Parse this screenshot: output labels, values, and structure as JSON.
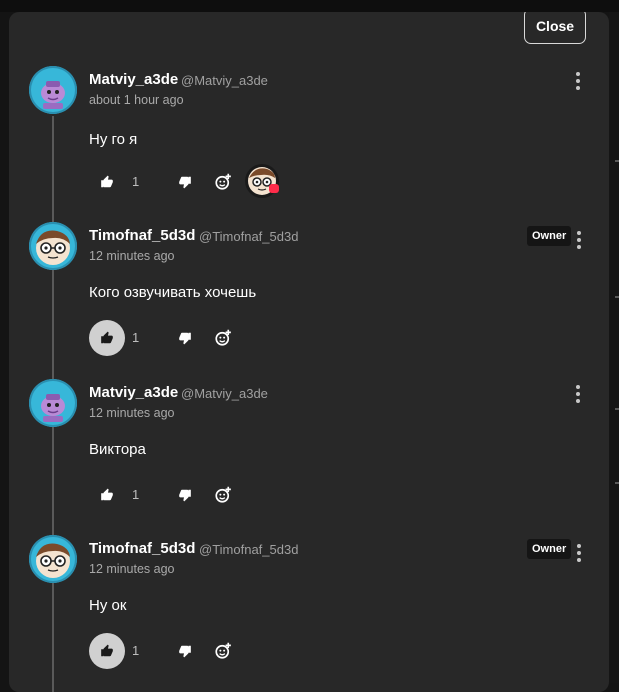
{
  "close_label": "Close",
  "owner_label": "Owner",
  "comments": [
    {
      "username": "Matviy_a3de",
      "handle": "@Matviy_a3de",
      "time": "about 1 hour ago",
      "text": "Ну го я",
      "likes": "1",
      "avatar": "purple-character-avatar",
      "liked": false
    },
    {
      "username": "Timofnaf_5d3d",
      "handle": "@Timofnaf_5d3d",
      "time": "12 minutes ago",
      "text": "Кого озвучивать хочешь",
      "likes": "1",
      "avatar": "glasses-face-avatar",
      "liked": true
    },
    {
      "username": "Matviy_a3de",
      "handle": "@Matviy_a3de",
      "time": "12 minutes ago",
      "text": "Виктора",
      "likes": "1",
      "avatar": "purple-character-avatar",
      "liked": false
    },
    {
      "username": "Timofnaf_5d3d",
      "handle": "@Timofnaf_5d3d",
      "time": "12 minutes ago",
      "text": "Ну ок",
      "likes": "1",
      "avatar": "glasses-face-avatar",
      "liked": true
    }
  ],
  "icons": {
    "like": "thumbs-up-icon",
    "dislike": "thumbs-down-icon",
    "react": "add-reaction-icon",
    "menu": "more-vertical-icon"
  },
  "colors": {
    "panel": "#282828",
    "background": "#141414",
    "avatar_ring": "#37b7d9",
    "reaction_dot": "#ff2c4a"
  }
}
